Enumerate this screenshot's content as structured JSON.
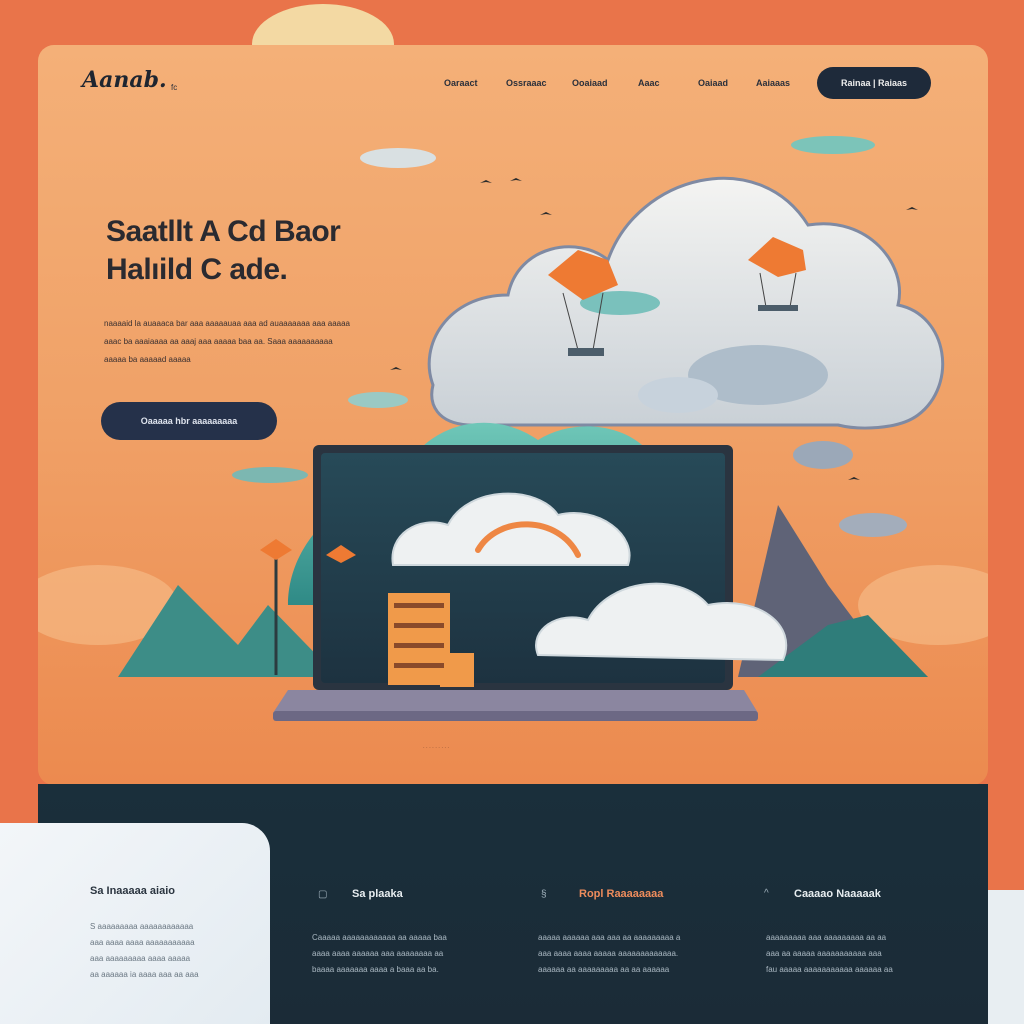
{
  "header": {
    "logo": "Aanab.",
    "logo_sub": "fc",
    "nav": [
      "Oaraact",
      "Ossraaac",
      "Ooaiaad",
      "Aaac",
      "Oaiaad",
      "Aaiaaas"
    ],
    "cta": "Rainaa | Raiaas"
  },
  "hero": {
    "headline_line1": "Saatllt A Cd Baor",
    "headline_line2": "Halıild C ade.",
    "body_line1": "naaaaid la auaaaca bar aaa aaaaauaa aaa ad auaaaaaaa aaa aaaaa",
    "body_line2": "aaac ba aaaiaaaa aa aaaj aaa aaaaa baa aa. Saaa aaaaaaaaaa",
    "body_line3": "aaaaa ba aaaaad aaaaa",
    "cta": "Oaaaaa   hbr aaaaaaaaa"
  },
  "footer": {
    "left": {
      "title": "Sa Inaaaaa aiaio",
      "lines": [
        "S aaaaaaaaa aaaaaaaaaaaa",
        "aaa aaaa aaaa aaaaaaaaaaa",
        "aaa aaaaaaaaa aaaa aaaaa",
        "aa aaaaaa ia aaaa aaa aa aaa"
      ]
    },
    "col1": {
      "title": "Sa  plaaka",
      "lines": [
        "Caaaaa aaaaaaaaaaaa aa aaaaa baa",
        "aaaa aaaa aaaaaa aaa aaaaaaaa aa",
        "baaaa aaaaaaa aaaa a baaa aa ba."
      ]
    },
    "col2": {
      "title": "Ropl  Raaaaaaaa",
      "lines": [
        "aaaaa aaaaaa aaa aaa aa aaaaaaaaa a",
        "aaa aaaa aaaa aaaaa aaaaaaaaaaaaa.",
        "aaaaaa aa aaaaaaaaa aa aa aaaaaa"
      ]
    },
    "col3": {
      "title": "Caaaao Naaaaak",
      "lines": [
        "aaaaaaaaa aaa aaaaaaaaa aa aa",
        "aaa aa aaaaa aaaaaaaaaaa aaa",
        "fau aaaaa aaaaaaaaaaa aaaaaa aa"
      ]
    }
  },
  "colors": {
    "accent": "#ee8744",
    "dark": "#1b2b37",
    "teal": "#3fa8a0"
  }
}
